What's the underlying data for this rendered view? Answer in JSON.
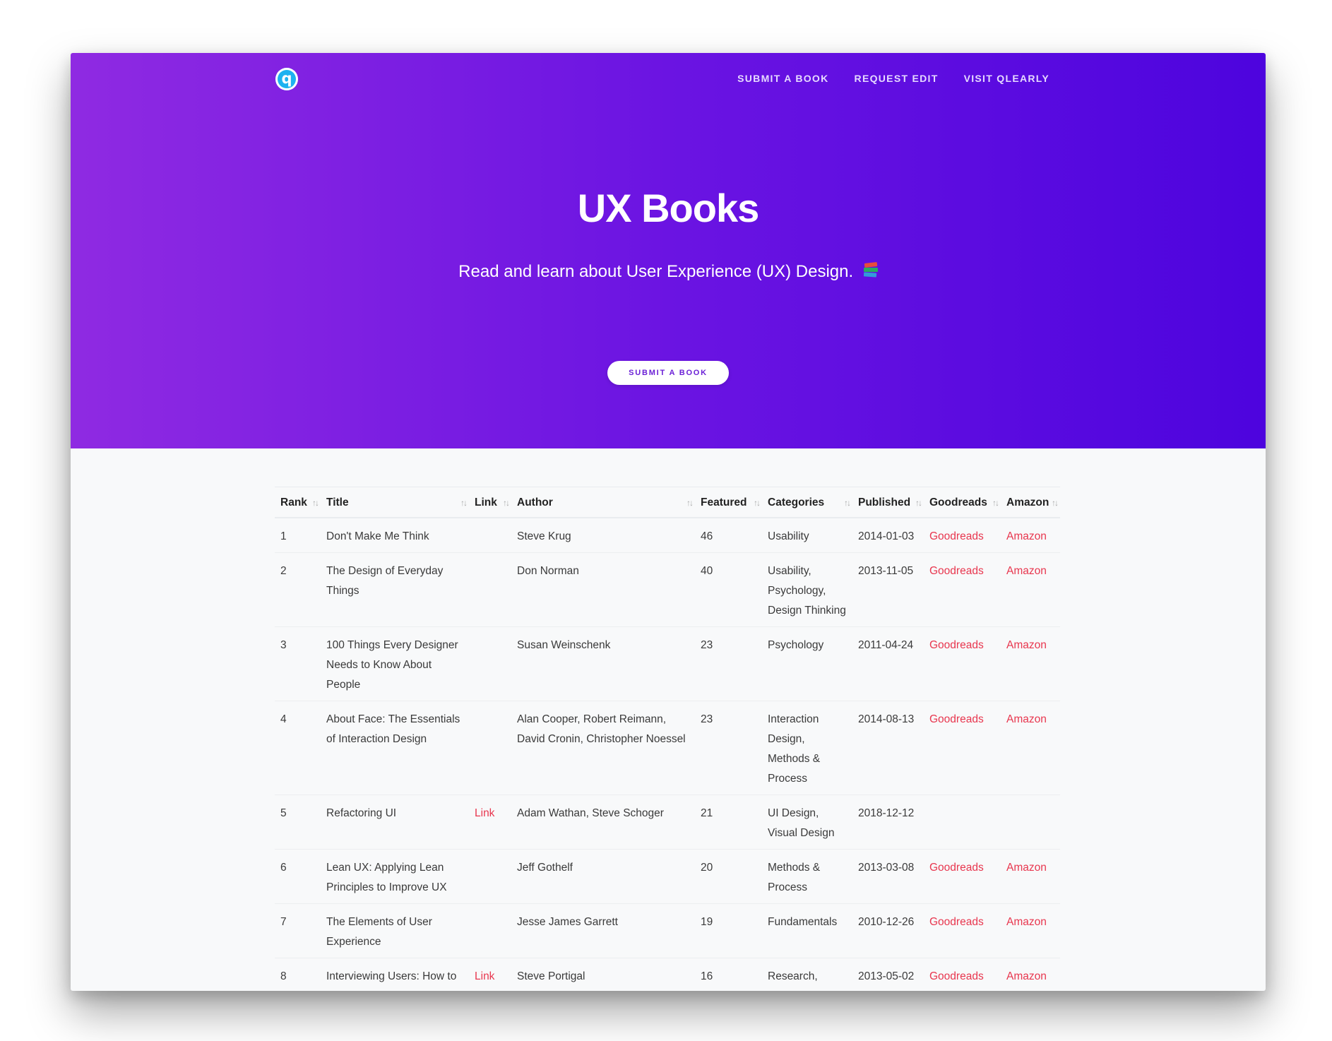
{
  "nav": {
    "logo_letter": "q",
    "items": [
      "SUBMIT A BOOK",
      "REQUEST EDIT",
      "VISIT QLEARLY"
    ]
  },
  "hero": {
    "title": "UX Books",
    "subtitle": "Read and learn about User Experience (UX) Design.",
    "button_label": "SUBMIT A BOOK"
  },
  "table": {
    "columns": [
      "Rank",
      "Title",
      "Link",
      "Author",
      "Featured",
      "Categories",
      "Published",
      "Goodreads",
      "Amazon"
    ],
    "sort_icon": "↑↓",
    "rows": [
      {
        "rank": "1",
        "title": "Don't Make Me Think",
        "link": "",
        "author": "Steve Krug",
        "featured": "46",
        "categories": "Usability",
        "published": "2014-01-03",
        "goodreads": "Goodreads",
        "amazon": "Amazon"
      },
      {
        "rank": "2",
        "title": "The Design of Everyday Things",
        "link": "",
        "author": "Don Norman",
        "featured": "40",
        "categories": "Usability, Psychology, Design Thinking",
        "published": "2013-11-05",
        "goodreads": "Goodreads",
        "amazon": "Amazon"
      },
      {
        "rank": "3",
        "title": "100 Things Every Designer Needs to Know About People",
        "link": "",
        "author": "Susan Weinschenk",
        "featured": "23",
        "categories": "Psychology",
        "published": "2011-04-24",
        "goodreads": "Goodreads",
        "amazon": "Amazon"
      },
      {
        "rank": "4",
        "title": "About Face: The Essentials of Interaction Design",
        "link": "",
        "author": "Alan Cooper, Robert Reimann, David Cronin, Christopher Noessel",
        "featured": "23",
        "categories": "Interaction Design, Methods & Process",
        "published": "2014-08-13",
        "goodreads": "Goodreads",
        "amazon": "Amazon"
      },
      {
        "rank": "5",
        "title": "Refactoring UI",
        "link": "Link",
        "author": "Adam Wathan, Steve Schoger",
        "featured": "21",
        "categories": "UI Design, Visual Design",
        "published": "2018-12-12",
        "goodreads": "",
        "amazon": ""
      },
      {
        "rank": "6",
        "title": "Lean UX: Applying Lean Principles to Improve UX",
        "link": "",
        "author": "Jeff Gothelf",
        "featured": "20",
        "categories": "Methods & Process",
        "published": "2013-03-08",
        "goodreads": "Goodreads",
        "amazon": "Amazon"
      },
      {
        "rank": "7",
        "title": "The Elements of User Experience",
        "link": "",
        "author": "Jesse James Garrett",
        "featured": "19",
        "categories": "Fundamentals",
        "published": "2010-12-26",
        "goodreads": "Goodreads",
        "amazon": "Amazon"
      },
      {
        "rank": "8",
        "title": "Interviewing Users: How to Uncover Compelling Insights",
        "link": "Link",
        "author": "Steve Portigal",
        "featured": "16",
        "categories": "Research, Methods & Process",
        "published": "2013-05-02",
        "goodreads": "Goodreads",
        "amazon": "Amazon"
      }
    ]
  }
}
